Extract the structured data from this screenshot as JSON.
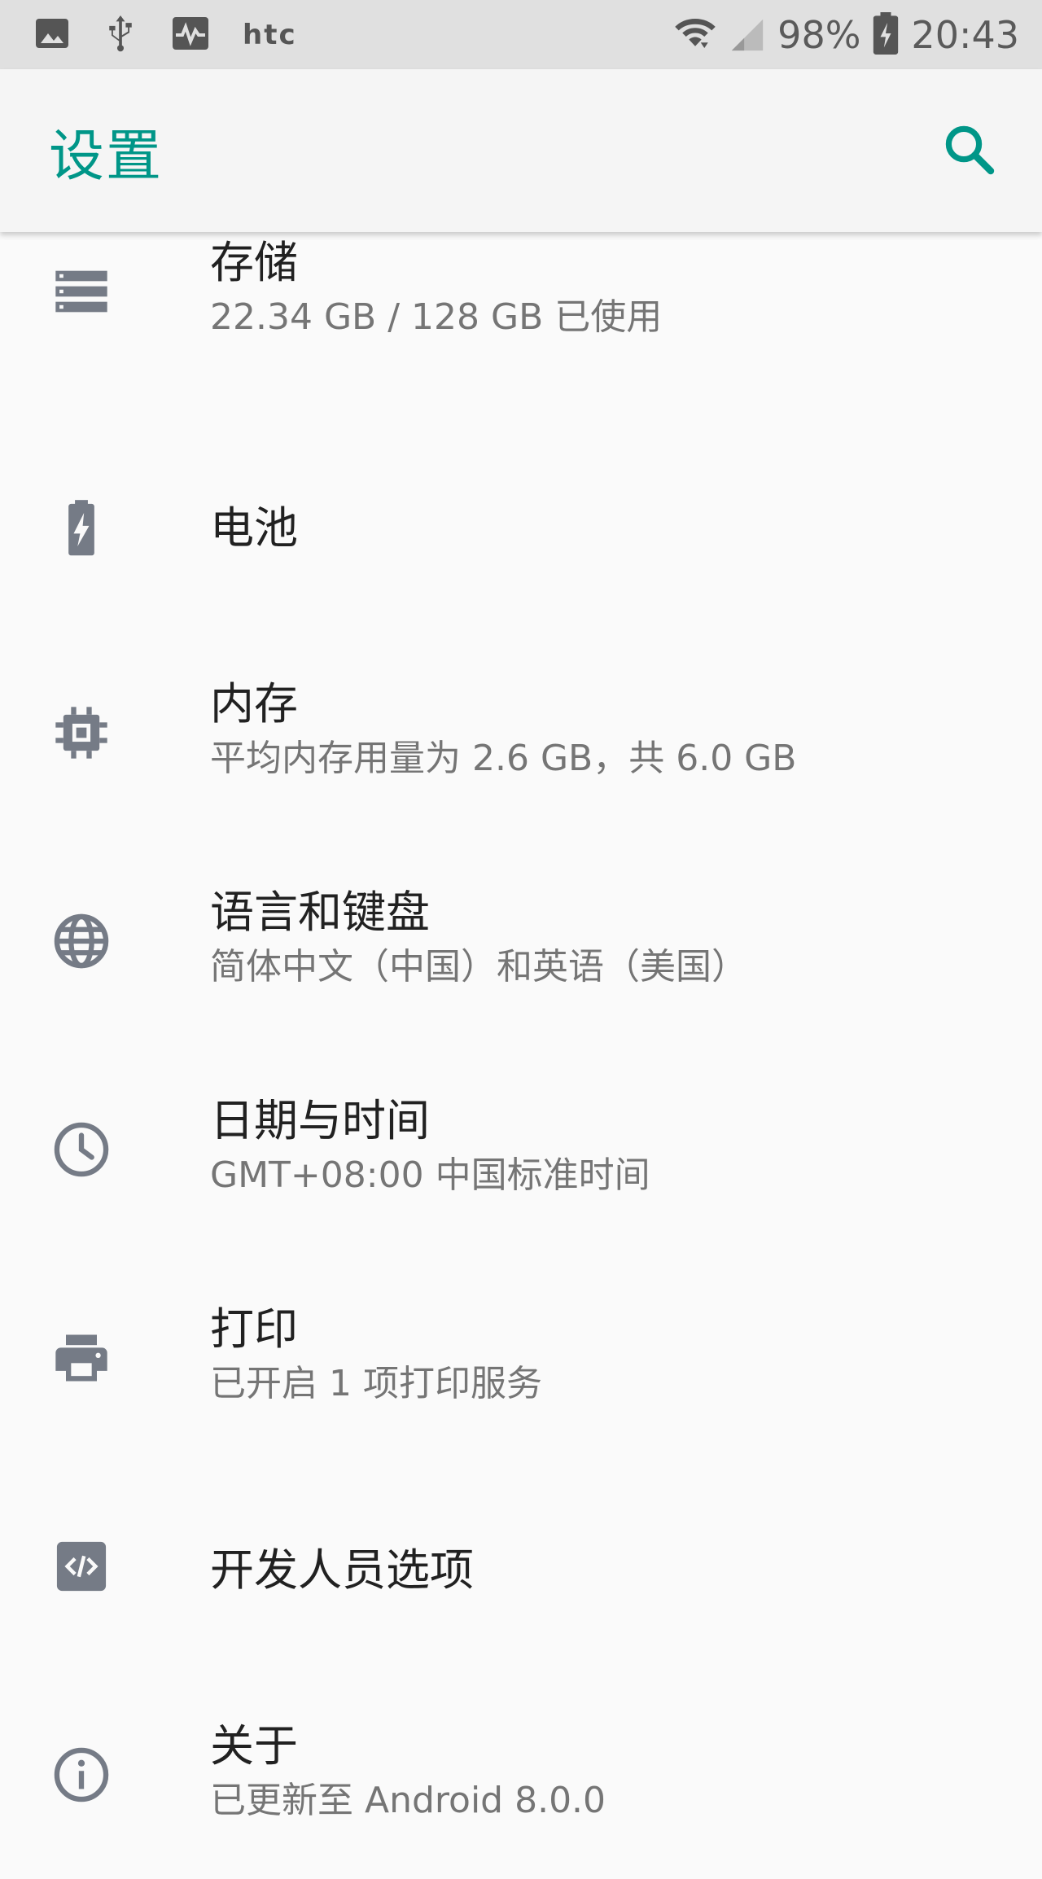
{
  "status_bar": {
    "carrier": "htc",
    "battery": "98%",
    "time": "20:43",
    "icons": [
      "image-icon",
      "usb-icon",
      "pulse-icon",
      "wifi-icon",
      "signal-icon",
      "battery-charging-icon"
    ]
  },
  "app_bar": {
    "title": "设置",
    "search_icon": "search-icon"
  },
  "settings": {
    "items": [
      {
        "title": "存储",
        "summary": "22.34 GB / 128 GB 已使用",
        "icon": "storage-icon"
      },
      {
        "title": "电池",
        "summary": "",
        "icon": "battery-icon"
      },
      {
        "title": "内存",
        "summary": "平均内存用量为 2.6 GB，共 6.0 GB",
        "icon": "memory-icon"
      },
      {
        "title": "语言和键盘",
        "summary": "简体中文（中国）和英语（美国）",
        "icon": "globe-icon"
      },
      {
        "title": "日期与时间",
        "summary": "GMT+08:00 中国标准时间",
        "icon": "clock-icon"
      },
      {
        "title": "打印",
        "summary": "已开启 1 项打印服务",
        "icon": "printer-icon"
      },
      {
        "title": "开发人员选项",
        "summary": "",
        "icon": "developer-icon"
      },
      {
        "title": "关于",
        "summary": "已更新至 Android 8.0.0",
        "icon": "info-icon"
      }
    ]
  },
  "colors": {
    "accent": "#009688",
    "icon": "#757b86",
    "title_text": "#212121",
    "summary_text": "#757575",
    "background": "#fafafa",
    "status_bar": "#e0e0e0"
  }
}
